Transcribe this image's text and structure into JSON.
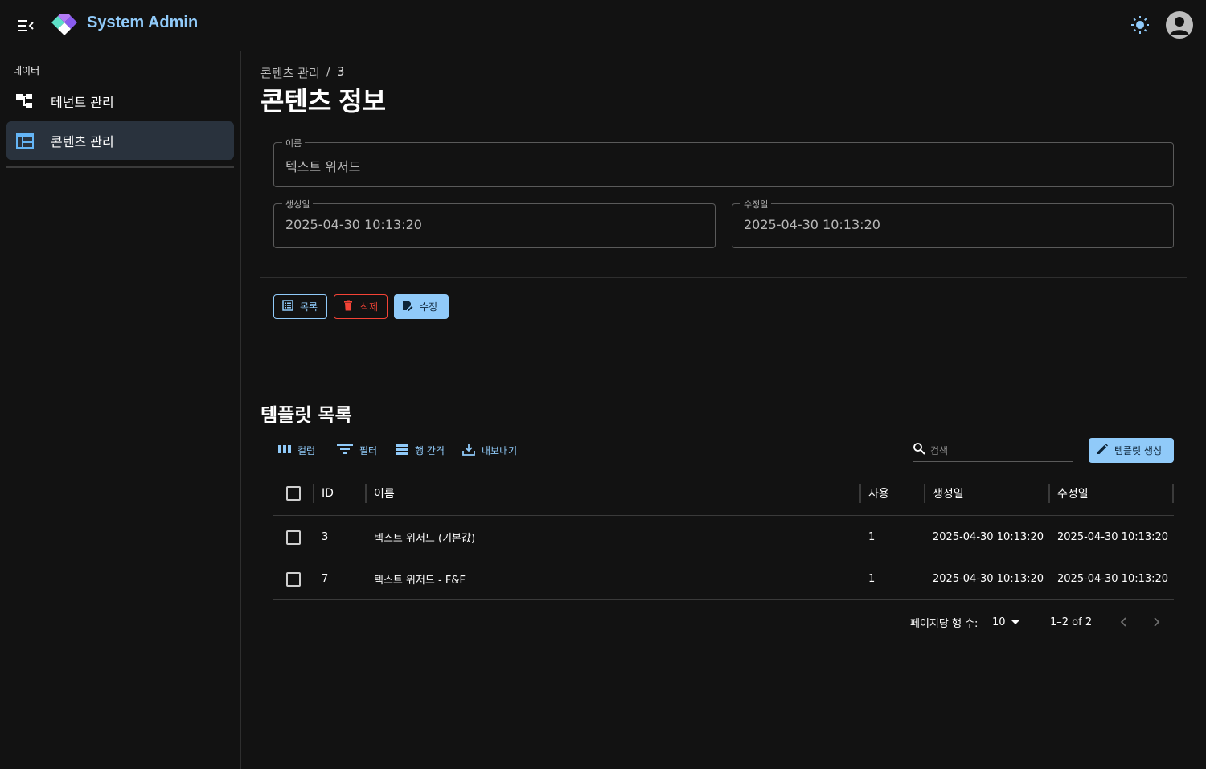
{
  "app": {
    "title": "System Admin"
  },
  "icons": {
    "menu": "menu-open-icon",
    "logo": "diamond-logo",
    "theme": "sun-icon",
    "avatar": "account-icon"
  },
  "colors": {
    "accent": "#90caf9",
    "danger": "#f44336",
    "background": "#121212",
    "active_nav": "#29323d"
  },
  "sidebar": {
    "section_label": "데이터",
    "items": [
      {
        "label": "테넌트 관리",
        "icon": "tenant-tree-icon",
        "active": false
      },
      {
        "label": "콘텐츠 관리",
        "icon": "content-table-icon",
        "active": true
      }
    ]
  },
  "breadcrumb": {
    "parent": "콘텐츠 관리",
    "separator": "/",
    "current": "3"
  },
  "page_title": "콘텐츠 정보",
  "form": {
    "name": {
      "label": "이름",
      "value": "텍스트 위저드"
    },
    "created": {
      "label": "생성일",
      "value": "2025-04-30 10:13:20"
    },
    "updated": {
      "label": "수정일",
      "value": "2025-04-30 10:13:20"
    }
  },
  "actions": {
    "list": "목록",
    "delete": "삭제",
    "edit": "수정"
  },
  "templates": {
    "title": "템플릿 목록",
    "toolbar": {
      "columns": "컬럼",
      "filter": "필터",
      "density": "행 간격",
      "export": "내보내기"
    },
    "search_placeholder": "검색",
    "create_label": "템플릿 생성",
    "columns": [
      "ID",
      "이름",
      "사용",
      "생성일",
      "수정일"
    ],
    "rows": [
      {
        "id": "3",
        "name": "텍스트 위저드 (기본값)",
        "use": "1",
        "created": "2025-04-30 10:13:20",
        "updated": "2025-04-30 10:13:20"
      },
      {
        "id": "7",
        "name": "텍스트 위저드 - F&F",
        "use": "1",
        "created": "2025-04-30 10:13:20",
        "updated": "2025-04-30 10:13:20"
      }
    ],
    "pagination": {
      "rows_per_page_label": "페이지당 행 수:",
      "rows_per_page": "10",
      "range": "1–2 of 2"
    }
  }
}
